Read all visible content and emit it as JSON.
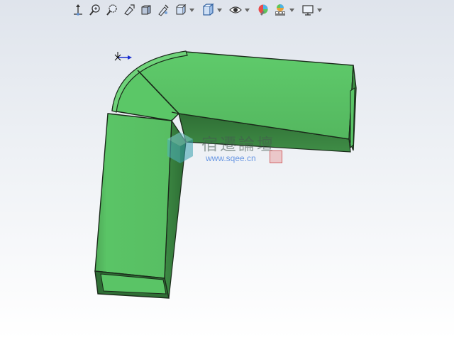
{
  "toolbar": {
    "buttons": [
      {
        "icon": "view-orientation-icon"
      },
      {
        "icon": "zoom-to-fit-icon"
      },
      {
        "icon": "zoom-to-area-icon"
      },
      {
        "icon": "previous-view-icon"
      },
      {
        "icon": "section-view-icon"
      },
      {
        "icon": "dynamic-annotation-view-icon"
      },
      {
        "icon": "view-orientation-cube-icon"
      },
      {
        "icon": "display-style-icon"
      },
      {
        "icon": "hide-show-items-icon"
      },
      {
        "icon": "edit-appearance-icon"
      },
      {
        "icon": "apply-scene-icon"
      },
      {
        "icon": "view-settings-icon"
      }
    ]
  },
  "model": {
    "color": "#58be63",
    "shade_color": "#2e6f33",
    "edge_color": "#1a2a1a"
  },
  "watermark": {
    "site_name": "宿遷論壇",
    "url": "www.sqee.cn"
  },
  "colors": {
    "background_top": "#dfe4ec",
    "background_bottom": "#ffffff",
    "triad_x": "#1a2ed0"
  }
}
